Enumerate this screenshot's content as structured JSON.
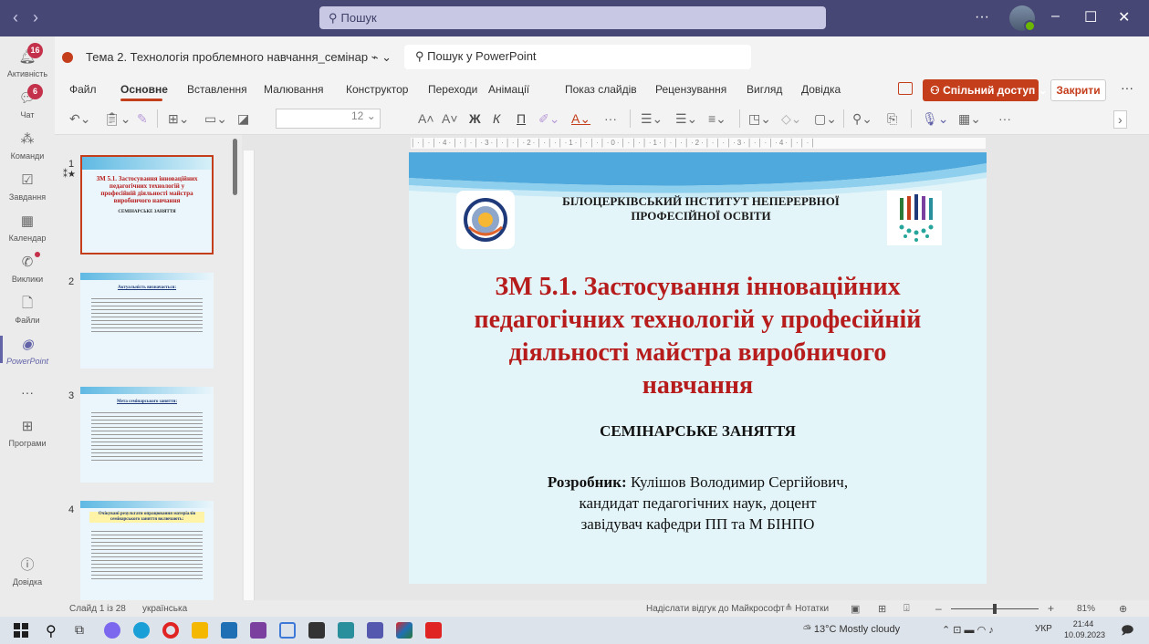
{
  "titlebar": {
    "back": "‹",
    "forward": "›",
    "search_label": "Пошук",
    "more": "···",
    "minimize": "–",
    "maximize": "☐",
    "close": "✕"
  },
  "rail": {
    "items": [
      {
        "label": "Активність",
        "badge": "16"
      },
      {
        "label": "Чат",
        "badge": "6"
      },
      {
        "label": "Команди"
      },
      {
        "label": "Завдання"
      },
      {
        "label": "Календар"
      },
      {
        "label": "Виклики"
      },
      {
        "label": "Файли"
      },
      {
        "label": "PowerPoint"
      },
      {
        "label": "Програми"
      },
      {
        "label": "Довідка"
      }
    ]
  },
  "doc": {
    "title": "Тема 2. Технологія проблемного навчання_семінар",
    "search_placeholder": "Пошук у PowerPoint"
  },
  "menu": {
    "items": [
      "Файл",
      "Основне",
      "Вставлення",
      "Малювання",
      "Конструктор",
      "Переходи",
      "Анімації",
      "Показ слайдів",
      "Рецензування",
      "Вигляд",
      "Довідка"
    ],
    "share": "Спільний доступ",
    "close": "Закрити"
  },
  "toolbar": {
    "font_size": "12",
    "bold": "Ж",
    "italic": "К",
    "underline": "П"
  },
  "slides": [
    {
      "number": "1",
      "title": "ЗМ 5.1. Застосування інноваційних педагогічних технологій у професійній діяльності майстра виробничого навчання",
      "subtitle": "СЕМІНАРСЬКЕ ЗАНЯТТЯ"
    },
    {
      "number": "2",
      "title": "Актуальність визначається:"
    },
    {
      "number": "3",
      "title": "Мета семінарського заняття:"
    },
    {
      "number": "4",
      "title": "Очікувані результати опрацювання матеріалів семінарського заняття включають:"
    }
  ],
  "slide": {
    "institute": "БІЛОЦЕРКІВСЬКИЙ ІНСТИТУТ НЕПЕРЕРВНОЇ ПРОФЕСІЙНОЇ ОСВІТИ",
    "title": "ЗМ 5.1. Застосування інноваційних педагогічних технологій у професійній діяльності майстра виробничого навчання",
    "subtitle": "СЕМІНАРСЬКЕ ЗАНЯТТЯ",
    "author_label": "Розробник:",
    "author_name": "Кулішов Володимир Сергійович,",
    "author_degree": "кандидат педагогічних наук, доцент",
    "author_position": "завідувач кафедри ПП та М БІНПО"
  },
  "status": {
    "slide_info": "Слайд 1 із 28",
    "language": "українська",
    "feedback": "Надіслати відгук до Майкрософт",
    "notes": "Нотатки",
    "zoom": "81%",
    "zoom_fraction": 0.5
  },
  "taskbar": {
    "weather": "13°C  Mostly cloudy",
    "lang": "УКР",
    "time": "21:44",
    "date": "10.09.2023"
  },
  "colors": {
    "teams": "#464775",
    "accent": "#c43e1c",
    "slide_title": "#b71c1c",
    "slide_bg": "#e4f5f9"
  }
}
